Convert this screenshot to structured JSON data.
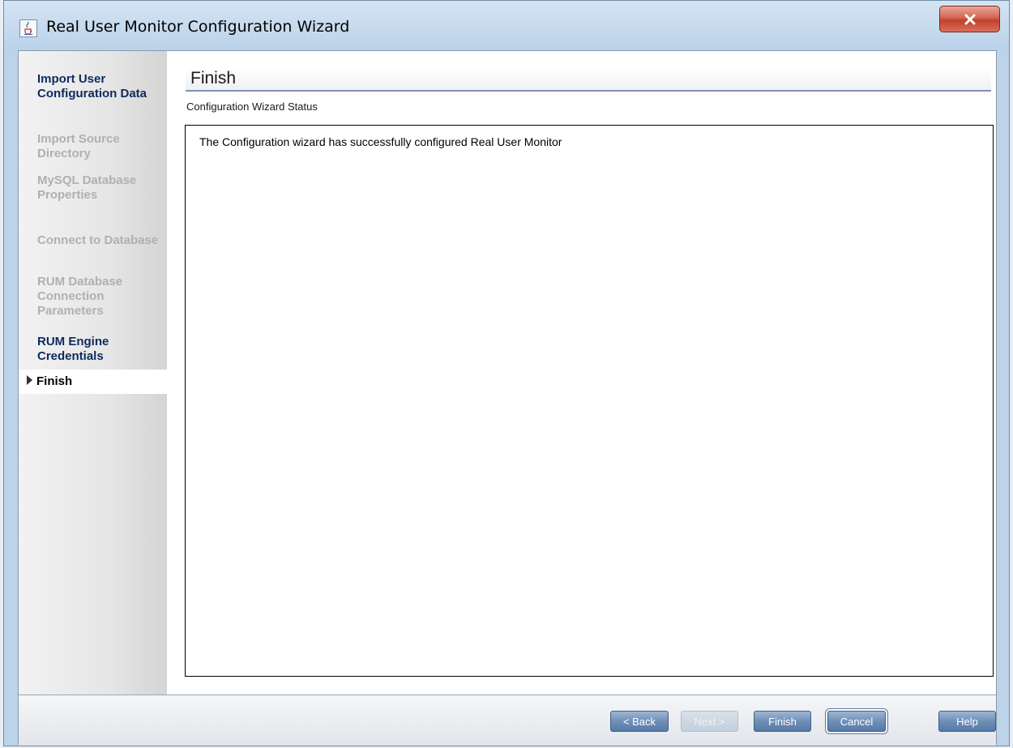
{
  "window": {
    "title": "Real User Monitor Configuration Wizard",
    "close_label": "X",
    "app_icon": "java-cup-icon"
  },
  "sidebar": {
    "items": [
      {
        "label": "Import User Configuration Data",
        "state": "done"
      },
      {
        "label": "Import Source Directory",
        "state": "disabled"
      },
      {
        "label": "MySQL Database Properties",
        "state": "disabled"
      },
      {
        "label": "Connect to Database",
        "state": "disabled"
      },
      {
        "label": "RUM Database Connection Parameters",
        "state": "disabled"
      },
      {
        "label": "RUM Engine Credentials",
        "state": "done"
      },
      {
        "label": "Finish",
        "state": "current"
      }
    ]
  },
  "main": {
    "title": "Finish",
    "subtitle": "Configuration Wizard Status",
    "status_message": "The Configuration wizard has successfully configured Real User Monitor"
  },
  "buttons": {
    "back": "< Back",
    "next": "Next >",
    "finish": "Finish",
    "cancel": "Cancel",
    "help": "Help"
  },
  "colors": {
    "accent": "#6f8fb8",
    "nav_done": "#0d2a5e",
    "nav_disabled": "#b0b0b0",
    "close": "#c2412a"
  }
}
